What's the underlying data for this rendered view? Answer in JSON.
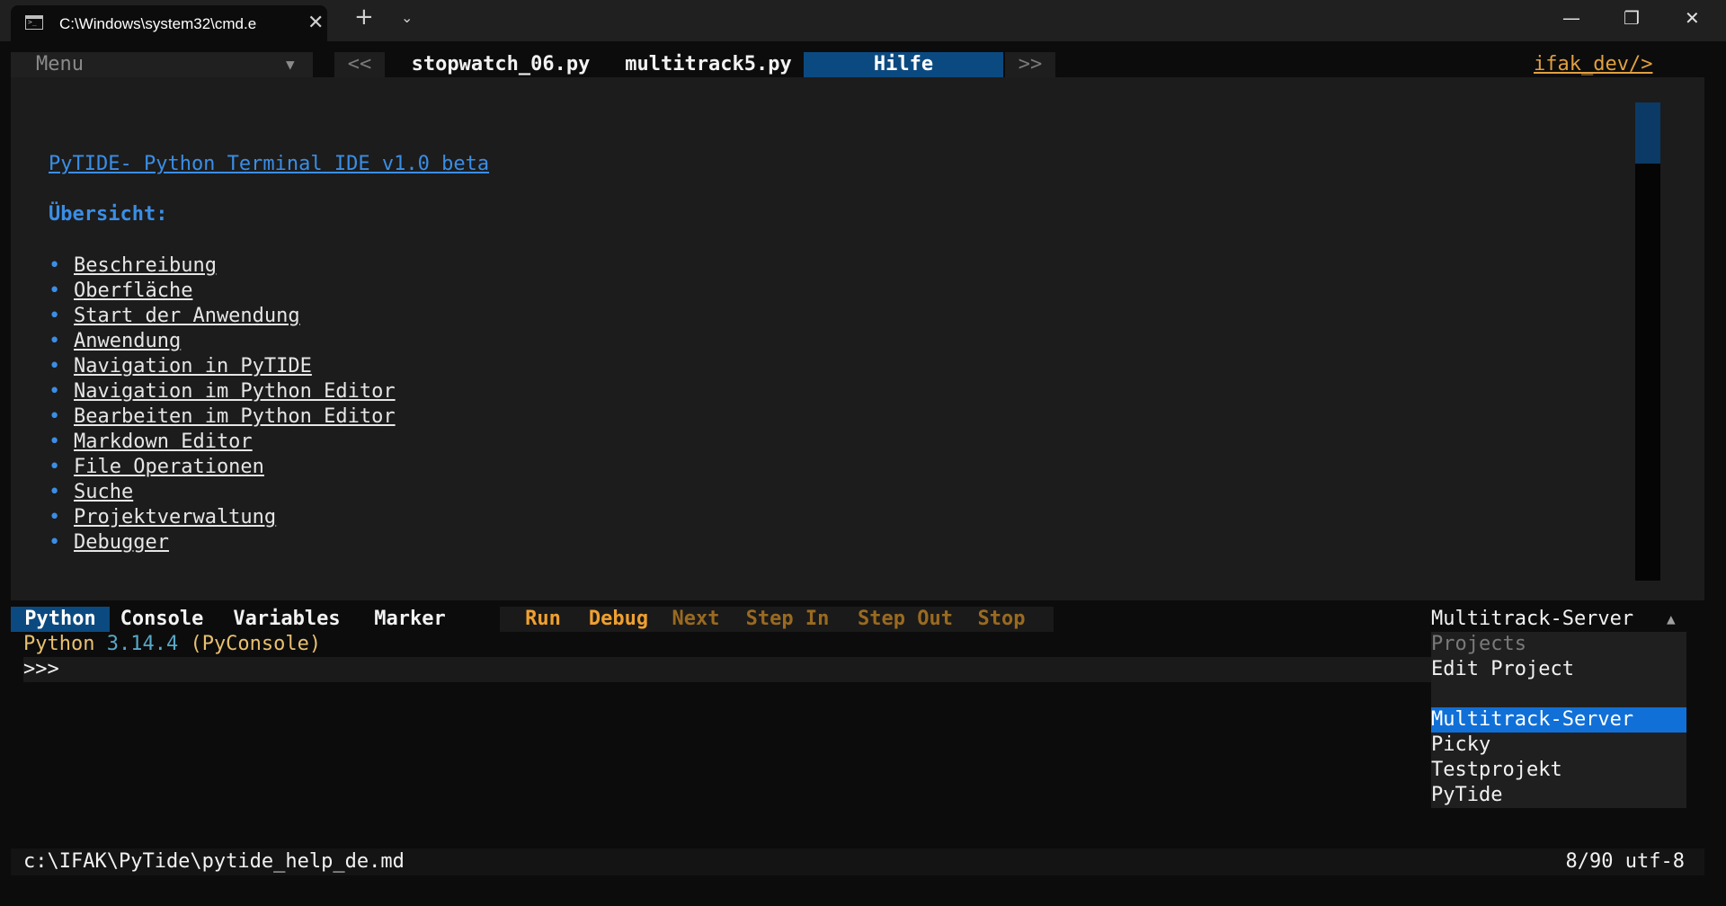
{
  "window": {
    "tab_title": "C:\\Windows\\system32\\cmd.e",
    "tab_close": "✕",
    "new_tab": "+",
    "tab_menu": "⌄",
    "minimize": "—",
    "maximize": "❐",
    "close": "✕"
  },
  "topbar": {
    "menu_label": "Menu",
    "menu_arrow": "▼",
    "prev": "<<",
    "next": ">>",
    "file_tabs": [
      "stopwatch_06.py",
      "multitrack5.py",
      "Hilfe"
    ],
    "active_tab": "Hilfe",
    "brand": "ifak_dev/>"
  },
  "help": {
    "title": "PyTIDE- Python Terminal IDE v1.0 beta",
    "subtitle": "Übersicht:",
    "bullet": "•",
    "toc": [
      "Beschreibung",
      "Oberfläche",
      "Start der Anwendung",
      "Anwendung",
      "Navigation in PyTIDE",
      "Navigation im Python Editor",
      "Bearbeiten im Python Editor",
      "Markdown Editor",
      "File Operationen",
      "Suche",
      "Projektverwaltung",
      "Debugger"
    ]
  },
  "bottom_tabs": {
    "python": "Python",
    "console": "Console",
    "variables": "Variables",
    "marker": "Marker"
  },
  "debug_controls": {
    "run": "Run",
    "debug": "Debug",
    "next": "Next",
    "step_in": "Step In",
    "step_out": "Step Out",
    "stop": "Stop"
  },
  "console": {
    "label_a": "Python ",
    "version": "3.14.4",
    "label_b": " (PyConsole)",
    "prompt": ">>>"
  },
  "projects": {
    "current": "Multitrack-Server",
    "arrow": "▲",
    "items": [
      {
        "label": "Projects"
      },
      {
        "label": "Edit Project"
      },
      {
        "label": "-----------------"
      },
      {
        "label": "Multitrack-Server"
      },
      {
        "label": "Picky"
      },
      {
        "label": "Testprojekt"
      },
      {
        "label": "PyTide"
      }
    ],
    "selected": "Multitrack-Server"
  },
  "status": {
    "path": "c:\\IFAK\\PyTide\\pytide_help_de.md",
    "info": "8/90 utf-8"
  },
  "colors": {
    "background": "#0c0c0c",
    "accent_blue": "#0b4a80",
    "link_blue": "#3a8ee6",
    "orange": "#f0a030",
    "selection": "#1070d8"
  }
}
